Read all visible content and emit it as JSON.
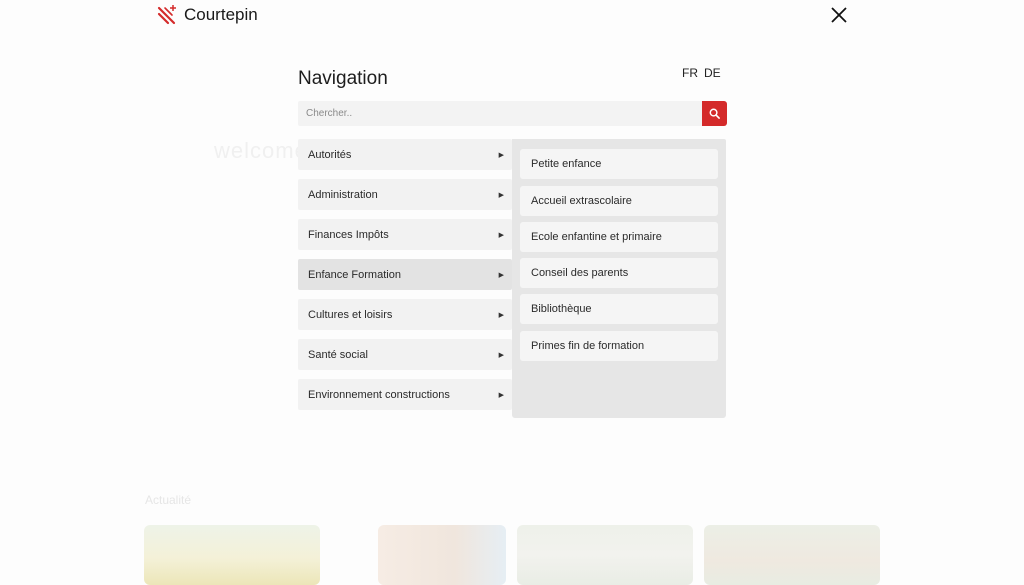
{
  "header": {
    "brand": "Courtepin",
    "logo_icon": "courtepin-emblem-icon",
    "close_icon": "close-icon"
  },
  "navigation": {
    "title": "Navigation",
    "languages": [
      "FR",
      "DE"
    ],
    "search": {
      "placeholder": "Chercher..",
      "value": "",
      "icon": "search-icon"
    },
    "menu": [
      {
        "label": "Autorités"
      },
      {
        "label": "Administration"
      },
      {
        "label": "Finances Impôts"
      },
      {
        "label": "Enfance Formation",
        "active": true
      },
      {
        "label": "Cultures et loisirs"
      },
      {
        "label": "Santé social"
      },
      {
        "label": "Environnement constructions"
      }
    ],
    "submenu": [
      {
        "label": "Petite enfance"
      },
      {
        "label": "Accueil extrascolaire"
      },
      {
        "label": "Ecole enfantine et primaire"
      },
      {
        "label": "Conseil des parents"
      },
      {
        "label": "Bibliothèque"
      },
      {
        "label": "Primes fin de formation"
      }
    ]
  },
  "background": {
    "welcome": "welcome",
    "section_title": "Actualité"
  },
  "colors": {
    "accent": "#d42a2a",
    "menu_bg": "#f2f2f2",
    "menu_active_bg": "#e3e3e3",
    "submenu_bg": "#e6e6e6"
  }
}
